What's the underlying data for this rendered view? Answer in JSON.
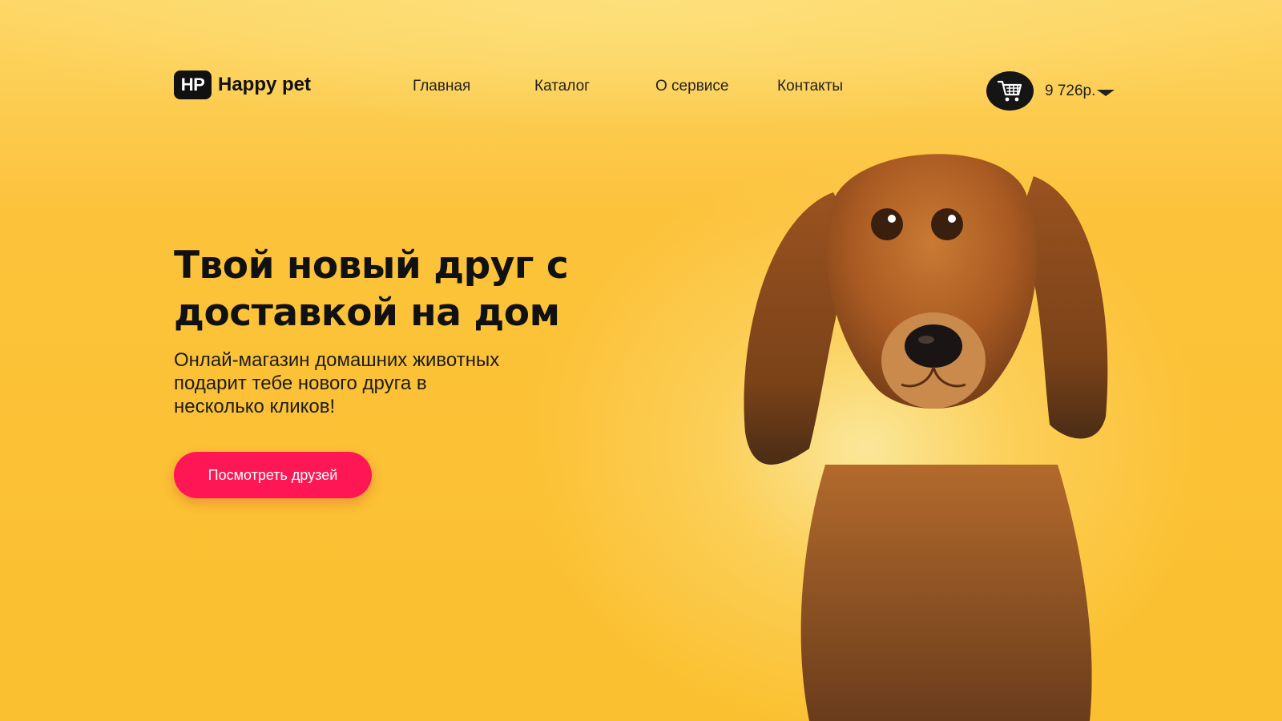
{
  "header": {
    "logo_badge": "HP",
    "logo_text": "Happy pet",
    "nav": [
      "Главная",
      "Каталог",
      "О сервисе",
      "Контакты"
    ],
    "cart_total": "9 726р.",
    "cart_icon": "cart-icon",
    "dropdown_icon": "caret-down-icon"
  },
  "hero": {
    "title": "Твой новый друг с доставкой на дом",
    "subtitle": "Онлай-магазин домашних животных подарит тебе нового друга в несколько кликов!",
    "cta_label": "Посмотреть друзей",
    "image": "dachshund-photo"
  },
  "colors": {
    "background": "#fbc02f",
    "accent": "#ff1654",
    "dark": "#111111"
  }
}
